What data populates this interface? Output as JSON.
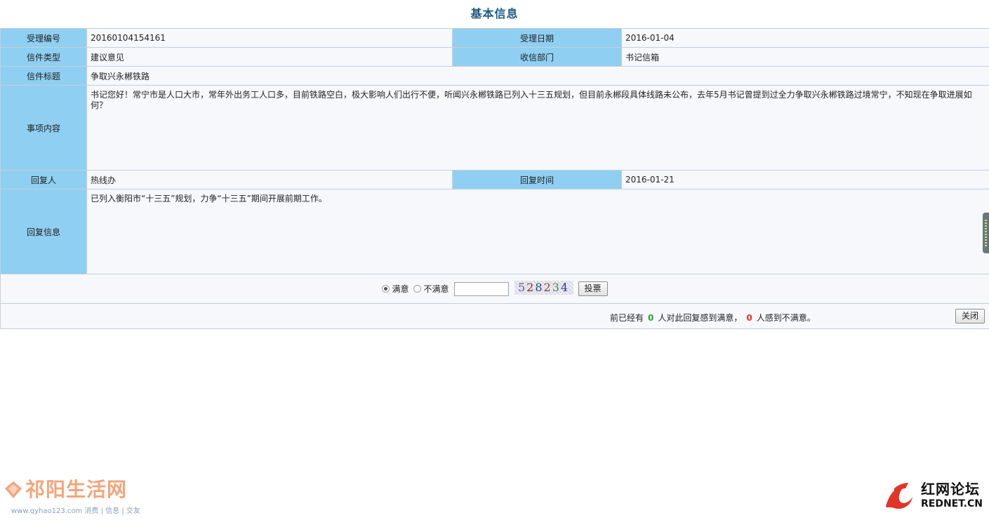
{
  "title": "基本信息",
  "fields": {
    "accept_no_label": "受理编号",
    "accept_no": "20160104154161",
    "accept_date_label": "受理日期",
    "accept_date": "2016-01-04",
    "letter_type_label": "信件类型",
    "letter_type": "建议意见",
    "dept_label": "收信部门",
    "dept": "书记信箱",
    "subject_label": "信件标题",
    "subject": "争取兴永郴铁路",
    "content_label": "事项内容",
    "content": "书记您好！常宁市是人口大市，常年外出务工人口多，目前铁路空白，极大影响人们出行不便，听闻兴永郴铁路已列入十三五规划，但目前永郴段具体线路未公布，去年5月书记曾提到过全力争取兴永郴铁路过境常宁，不知现在争取进展如何？",
    "replier_label": "回复人",
    "replier": "热线办",
    "reply_time_label": "回复时间",
    "reply_time": "2016-01-21",
    "reply_label": "回复信息",
    "reply": "已列入衡阳市“十三五”规划，力争“十三五”期间开展前期工作。"
  },
  "vote": {
    "satisfied_label": "满意",
    "unsatisfied_label": "不满意",
    "selected": "满意",
    "code_value": "",
    "captcha": [
      "5",
      "2",
      "8",
      "2",
      "3",
      "4"
    ],
    "submit_label": "投票"
  },
  "stats": {
    "prefix": "前已经有",
    "satisfied_count": "0",
    "mid": "人对此回复感到满意，",
    "unsatisfied_count": "0",
    "suffix": "人感到不满意。"
  },
  "close_label": "关闭",
  "watermarks": {
    "left_brand": "祁阳生活网",
    "left_sub": "www.qyhao123.com 消费 | 信息 | 交友",
    "right_brand": "红网论坛",
    "right_sub": "REDNET.CN"
  },
  "colors": {
    "label_bg": "#8fcff2",
    "cell_bg": "#f6f8fc",
    "title": "#1a5a8a",
    "count_green": "#2aa52a",
    "count_red": "#e0322a"
  }
}
